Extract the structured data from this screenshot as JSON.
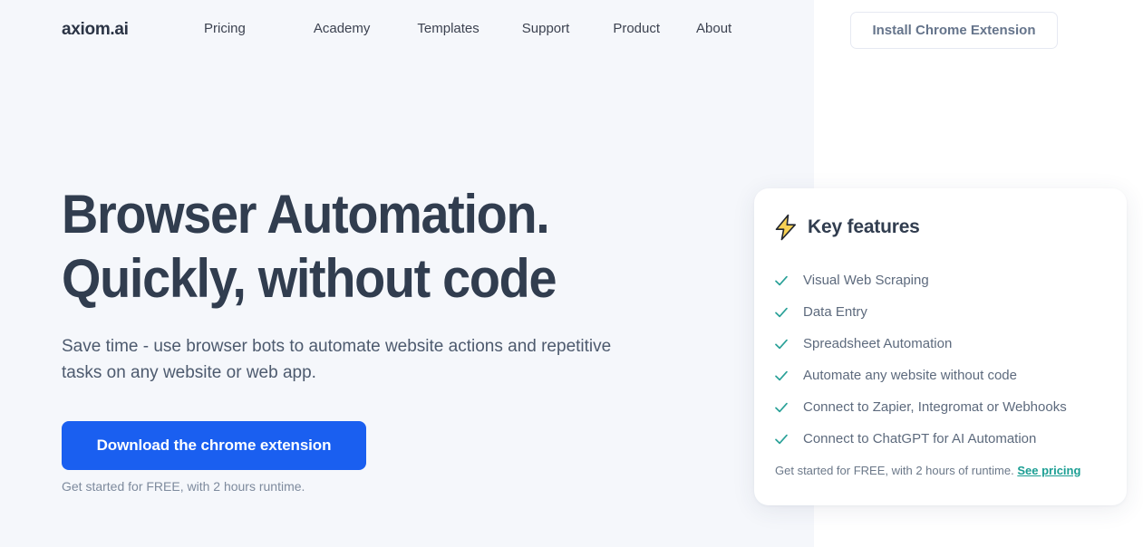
{
  "brand": {
    "name": "axiom.ai"
  },
  "nav": {
    "items": [
      {
        "label": "Pricing"
      },
      {
        "label": "Academy"
      },
      {
        "label": "Templates"
      },
      {
        "label": "Support"
      },
      {
        "label": "Product"
      },
      {
        "label": "About"
      }
    ],
    "install_button": "Install Chrome Extension"
  },
  "hero": {
    "title_line1": "Browser Automation.",
    "title_line2": "Quickly, without code",
    "subtitle": "Save time - use browser bots to automate website actions and repetitive tasks on any website or web app.",
    "cta_label": "Download the chrome extension",
    "cta_note": "Get started for FREE, with 2 hours runtime."
  },
  "features_card": {
    "icon": "lightning-bolt-icon",
    "title": "Key features",
    "items": [
      {
        "label": "Visual Web Scraping"
      },
      {
        "label": "Data Entry"
      },
      {
        "label": "Spreadsheet Automation"
      },
      {
        "label": "Automate any website without code"
      },
      {
        "label": "Connect to Zapier, Integromat or Webhooks"
      },
      {
        "label": "Connect to ChatGPT for AI Automation"
      }
    ],
    "footer_text": "Get started for FREE, with 2 hours of runtime.",
    "footer_link": "See pricing"
  },
  "colors": {
    "page_left_bg": "#f5f7fb",
    "page_right_bg": "#ffffff",
    "heading": "#313d4f",
    "body_text": "#4d5a6e",
    "cta_blue": "#1a5ff0",
    "check_teal": "#2aa198",
    "link_teal": "#1b9e93",
    "bolt_yellow": "#f7d154",
    "border_light": "#e6e9f2"
  }
}
